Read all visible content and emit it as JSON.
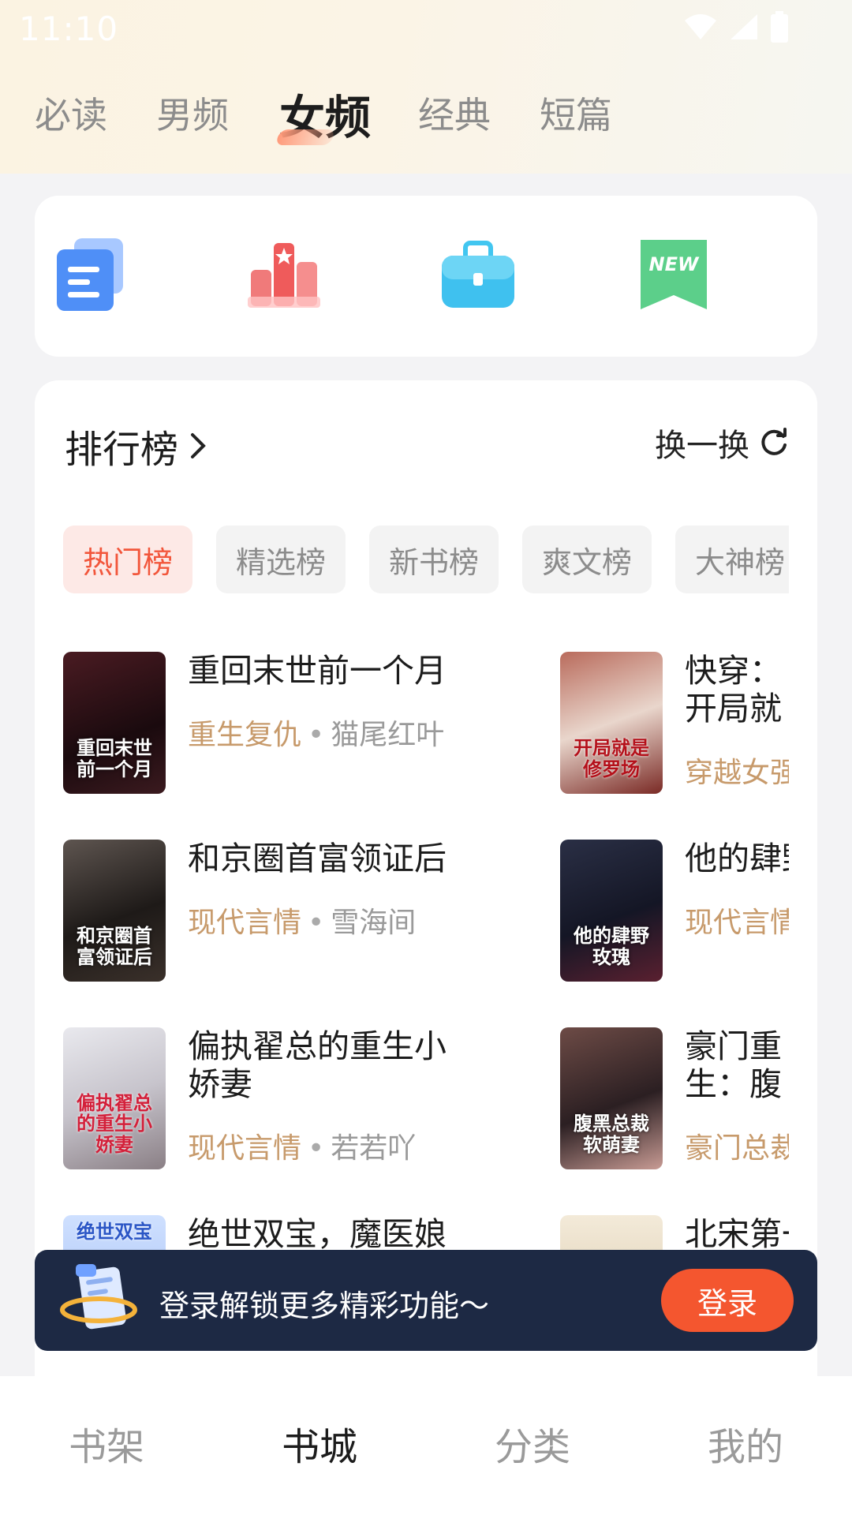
{
  "status_bar": {
    "time": "11:10"
  },
  "top_tabs": [
    "必读",
    "男频",
    "女频",
    "经典",
    "短篇"
  ],
  "top_tabs_active": 2,
  "quick_entries": [
    {
      "icon": "document-stack-icon"
    },
    {
      "icon": "ranking-podium-icon"
    },
    {
      "icon": "briefcase-icon"
    },
    {
      "icon": "new-badge-icon",
      "badge_text": "NEW"
    }
  ],
  "ranking": {
    "title": "排行榜",
    "refresh_label": "换一换",
    "chips": [
      "热门榜",
      "精选榜",
      "新书榜",
      "爽文榜",
      "大神榜"
    ],
    "active_chip": 0,
    "books_left": [
      {
        "title": "重回末世前一个月",
        "genre": "重生复仇",
        "author": "猫尾红叶",
        "cover_text": "重回末世前一个月"
      },
      {
        "title": "和京圈首富领证后",
        "genre": "现代言情",
        "author": "雪海间",
        "cover_text": "和京圈首富领证后"
      },
      {
        "title": "偏执翟总的重生小娇妻",
        "genre": "现代言情",
        "author": "若若吖",
        "cover_text": "偏执翟总的重生小娇妻"
      },
      {
        "title": "绝世双宝，魔医娘",
        "genre": "",
        "author": "",
        "cover_text": "绝世双宝"
      }
    ],
    "books_right": [
      {
        "title": "快穿：开局就是修罗场",
        "genre": "穿越女强",
        "author": "",
        "cover_text": "开局就是修罗场"
      },
      {
        "title": "他的肆野玫瑰",
        "genre": "现代言情",
        "author": "",
        "cover_text": "他的肆野玫瑰"
      },
      {
        "title": "豪门重生：腹黑总裁软萌妻",
        "genre": "豪门总裁",
        "author": "",
        "cover_text": "腹黑总裁软萌妻"
      },
      {
        "title": "北宋第一",
        "genre": "",
        "author": "",
        "cover_text": ""
      }
    ]
  },
  "login_banner": {
    "text": "登录解锁更多精彩功能～",
    "button": "登录"
  },
  "bottom_nav": [
    "书架",
    "书城",
    "分类",
    "我的"
  ],
  "bottom_nav_active": 1
}
